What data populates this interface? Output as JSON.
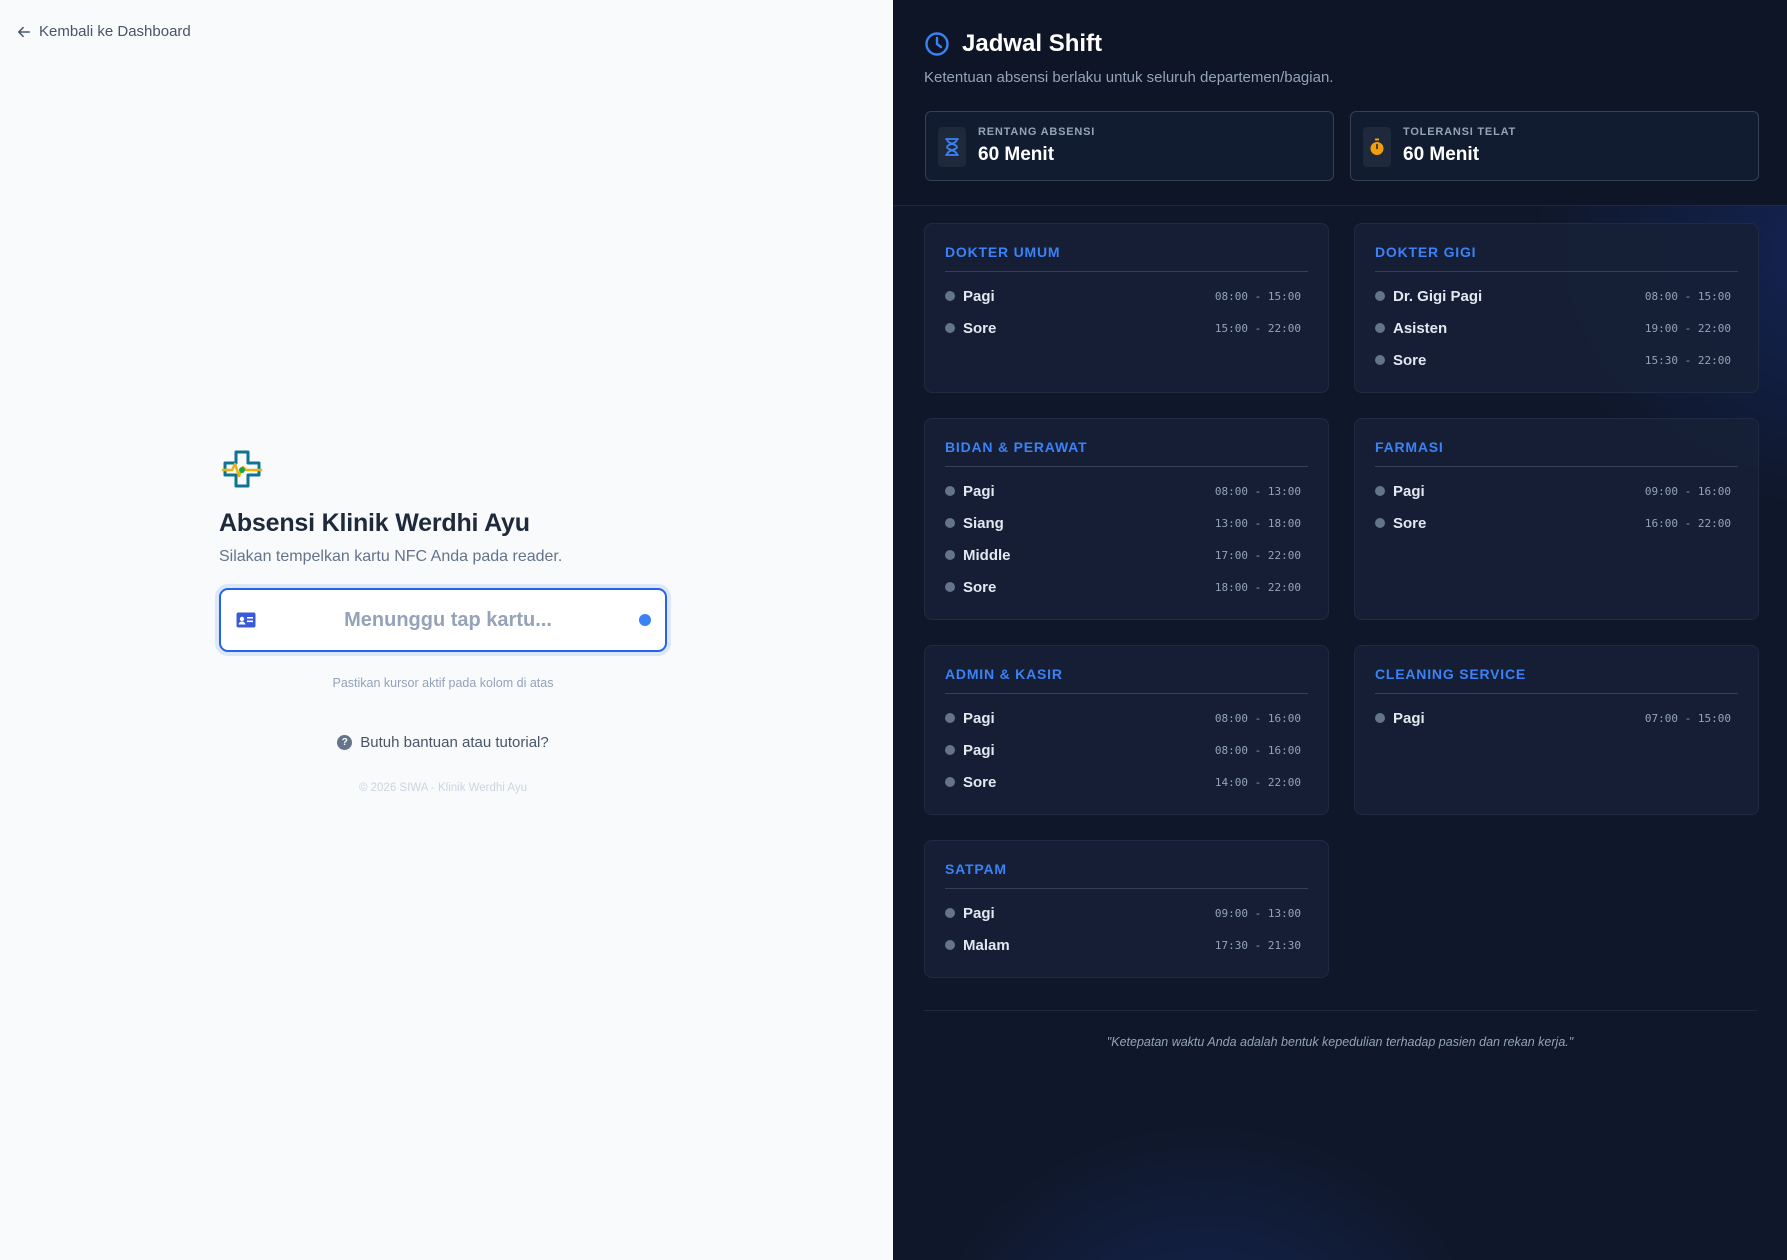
{
  "left": {
    "back_link": "Kembali ke Dashboard",
    "title": "Absensi Klinik Werdhi Ayu",
    "subtitle": "Silakan tempelkan kartu NFC Anda pada reader.",
    "nfc_placeholder": "Menunggu tap kartu...",
    "nfc_value": "",
    "hint": "Pastikan kursor aktif pada kolom di atas",
    "help": "Butuh bantuan atau tutorial?",
    "copyright": "© 2026 SIWA - Klinik Werdhi Ayu"
  },
  "schedule": {
    "title": "Jadwal Shift",
    "subtitle": "Ketentuan absensi berlaku untuk seluruh departemen/bagian.",
    "stats": [
      {
        "label": "RENTANG ABSENSI",
        "value": "60 Menit",
        "icon": "hourglass-icon"
      },
      {
        "label": "TOLERANSI TELAT",
        "value": "60 Menit",
        "icon": "stopwatch-icon"
      }
    ],
    "departments": [
      {
        "name": "DOKTER UMUM",
        "shifts": [
          {
            "name": "Pagi",
            "time": "08:00 - 15:00"
          },
          {
            "name": "Sore",
            "time": "15:00 - 22:00"
          }
        ]
      },
      {
        "name": "DOKTER GIGI",
        "shifts": [
          {
            "name": "Dr. Gigi Pagi",
            "time": "08:00 - 15:00"
          },
          {
            "name": "Asisten",
            "time": "19:00 - 22:00"
          },
          {
            "name": "Sore",
            "time": "15:30 - 22:00"
          }
        ]
      },
      {
        "name": "BIDAN & PERAWAT",
        "shifts": [
          {
            "name": "Pagi",
            "time": "08:00 - 13:00"
          },
          {
            "name": "Siang",
            "time": "13:00 - 18:00"
          },
          {
            "name": "Middle",
            "time": "17:00 - 22:00"
          },
          {
            "name": "Sore",
            "time": "18:00 - 22:00"
          }
        ]
      },
      {
        "name": "FARMASI",
        "shifts": [
          {
            "name": "Pagi",
            "time": "09:00 - 16:00"
          },
          {
            "name": "Sore",
            "time": "16:00 - 22:00"
          }
        ]
      },
      {
        "name": "ADMIN & KASIR",
        "shifts": [
          {
            "name": "Pagi",
            "time": "08:00 - 16:00"
          },
          {
            "name": "Pagi",
            "time": "08:00 - 16:00"
          },
          {
            "name": "Sore",
            "time": "14:00 - 22:00"
          }
        ]
      },
      {
        "name": "CLEANING SERVICE",
        "shifts": [
          {
            "name": "Pagi",
            "time": "07:00 - 15:00"
          }
        ]
      },
      {
        "name": "SATPAM",
        "shifts": [
          {
            "name": "Pagi",
            "time": "09:00 - 13:00"
          },
          {
            "name": "Malam",
            "time": "17:30 - 21:30"
          }
        ]
      }
    ],
    "quote": "\"Ketepatan waktu Anda adalah bentuk kepedulian terhadap pasien dan rekan kerja.\""
  },
  "colors": {
    "accent": "#2563eb",
    "dark_bg": "#0f172a",
    "dept_title": "#3b82f6",
    "stopwatch": "#f59e0b"
  }
}
